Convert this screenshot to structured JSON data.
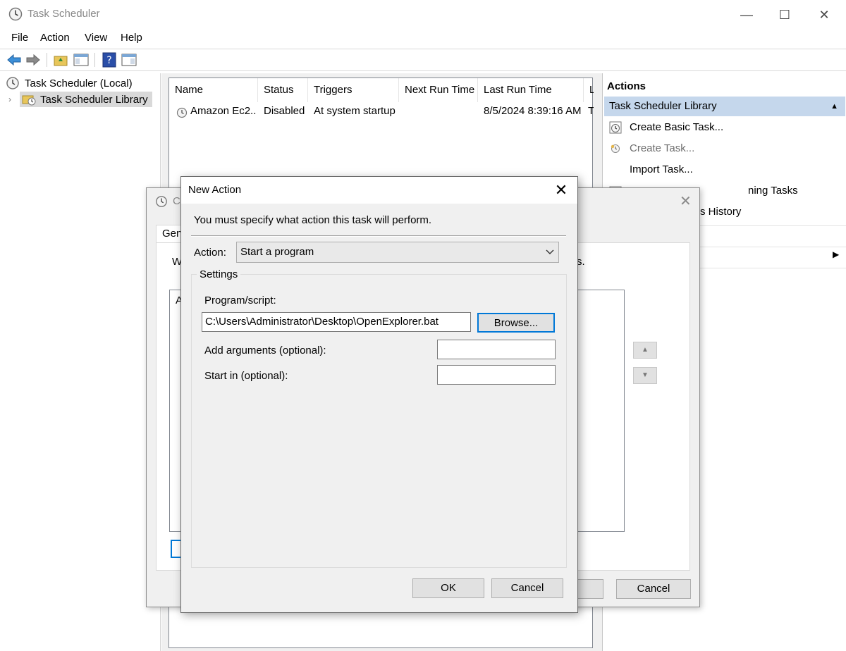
{
  "window": {
    "title": "Task Scheduler"
  },
  "menu": [
    "File",
    "Action",
    "View",
    "Help"
  ],
  "tree": {
    "root": "Task Scheduler (Local)",
    "library": "Task Scheduler Library"
  },
  "tasklist": {
    "columns": [
      "Name",
      "Status",
      "Triggers",
      "Next Run Time",
      "Last Run Time",
      "L"
    ],
    "rows": [
      {
        "name": "Amazon Ec2...",
        "status": "Disabled",
        "triggers": "At system startup",
        "next": "",
        "last": "8/5/2024 8:39:16 AM",
        "result": "T"
      }
    ]
  },
  "actions": {
    "header": "Actions",
    "section": "Task Scheduler Library",
    "items": [
      {
        "label": "Create Basic Task...",
        "icon": "create-basic-task-icon"
      },
      {
        "label": "Create Task...",
        "icon": "create-task-icon"
      },
      {
        "label": "Import Task...",
        "icon": ""
      },
      {
        "label": "ning Tasks",
        "icon": "display-running-tasks-icon"
      },
      {
        "label": "s History",
        "icon": ""
      }
    ]
  },
  "properties_dialog": {
    "title_fragment": "C",
    "tab_fragment": "Gen",
    "text_fragment_left": "W",
    "text_fragment_right": "s.",
    "list_fragment": "A",
    "cancel": "Cancel"
  },
  "new_action": {
    "title": "New Action",
    "instruction": "You must specify what action this task will perform.",
    "action_label": "Action:",
    "action_value": "Start a program",
    "settings_label": "Settings",
    "program_label": "Program/script:",
    "program_value": "C:\\Users\\Administrator\\Desktop\\OpenExplorer.bat",
    "browse": "Browse...",
    "args_label": "Add arguments (optional):",
    "args_value": "",
    "startin_label": "Start in (optional):",
    "startin_value": "",
    "ok": "OK",
    "cancel": "Cancel"
  },
  "colors": {
    "selection": "#c5d7ec",
    "accent": "#0078d7",
    "dialog_bg": "#f0f0f0"
  }
}
